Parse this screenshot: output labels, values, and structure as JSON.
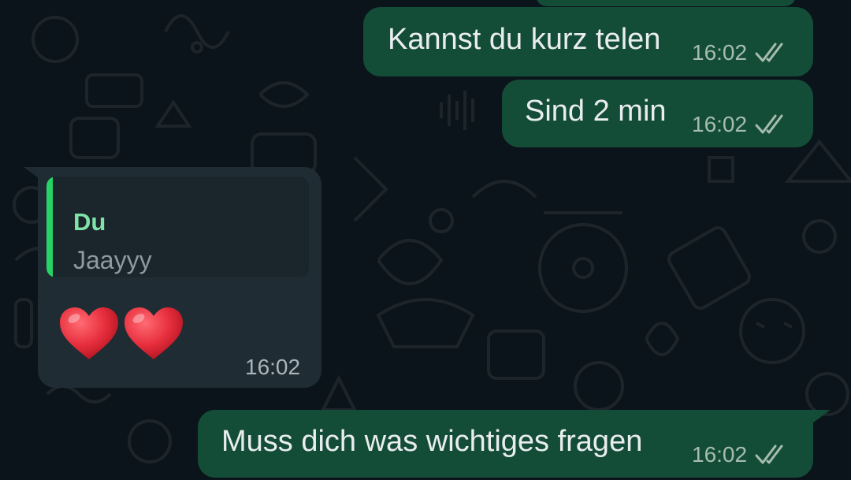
{
  "chat": {
    "messages": [
      {
        "id": "m1",
        "direction": "outgoing",
        "text": "Kannst du kurz telen",
        "time": "16:02",
        "status": "read"
      },
      {
        "id": "m2",
        "direction": "outgoing",
        "text": "Sind 2 min",
        "time": "16:02",
        "status": "read"
      },
      {
        "id": "m3",
        "direction": "incoming",
        "reply_to": {
          "author": "Du",
          "text": "Jaayyy"
        },
        "content": "heart-emoji x2",
        "time": "16:02"
      },
      {
        "id": "m4",
        "direction": "outgoing",
        "text": "Muss dich was wichtiges fragen",
        "time": "16:02",
        "status": "read"
      }
    ]
  },
  "colors": {
    "background": "#0b141a",
    "outgoing_bubble": "#144d37",
    "incoming_bubble": "#202c33",
    "quote_bar": "#25d366",
    "quote_author": "#7fe3a8",
    "heart": "#e8303f"
  },
  "icons": {
    "read_receipt": "double-check-icon",
    "heart": "red-heart-emoji"
  }
}
